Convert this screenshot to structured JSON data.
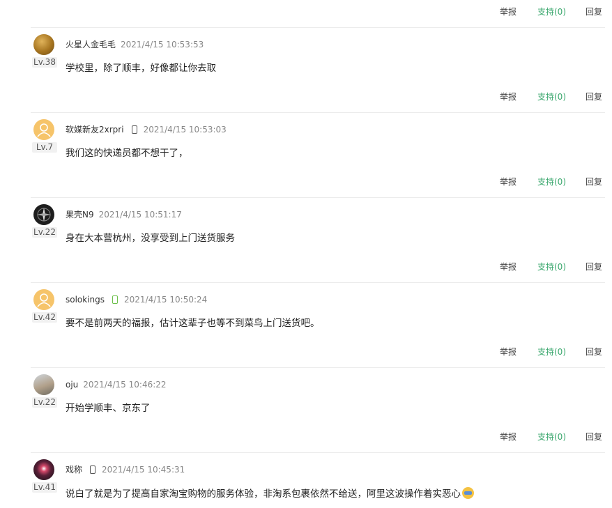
{
  "actions": {
    "report": "举报",
    "support": "支持(0)",
    "reply": "回复"
  },
  "comments": [
    {
      "username": "火星人金毛毛",
      "time": "2021/4/15 10:53:53",
      "level": "Lv.38",
      "content": "学校里，除了顺丰，好像都让你去取",
      "device": "none"
    },
    {
      "username": "软媒新友2xrpri",
      "time": "2021/4/15 10:53:03",
      "level": "Lv.7",
      "content": "我们这的快递员都不想干了，",
      "device": "phone"
    },
    {
      "username": "果壳N9",
      "time": "2021/4/15 10:51:17",
      "level": "Lv.22",
      "content": "身在大本营杭州，没享受到上门送货服务",
      "device": "none"
    },
    {
      "username": "solokings",
      "time": "2021/4/15 10:50:24",
      "level": "Lv.42",
      "content": "要不是前两天的福报，估计这辈子也等不到菜鸟上门送货吧。",
      "device": "android"
    },
    {
      "username": "oju",
      "time": "2021/4/15 10:46:22",
      "level": "Lv.22",
      "content": "开始学顺丰、京东了",
      "device": "none"
    },
    {
      "username": "戏称",
      "time": "2021/4/15 10:45:31",
      "level": "Lv.41",
      "content": "说白了就是为了提高自家淘宝购物的服务体验，非淘系包裹依然不给送，阿里这波操作着实恶心",
      "device": "phone"
    }
  ],
  "colors": {
    "support": "#3aa76d",
    "divider": "#ececec",
    "android": "#6cc04a"
  },
  "icons": [
    "phone-icon",
    "android-phone-icon",
    "emoji-mask-icon",
    "user-default-avatar-icon"
  ]
}
